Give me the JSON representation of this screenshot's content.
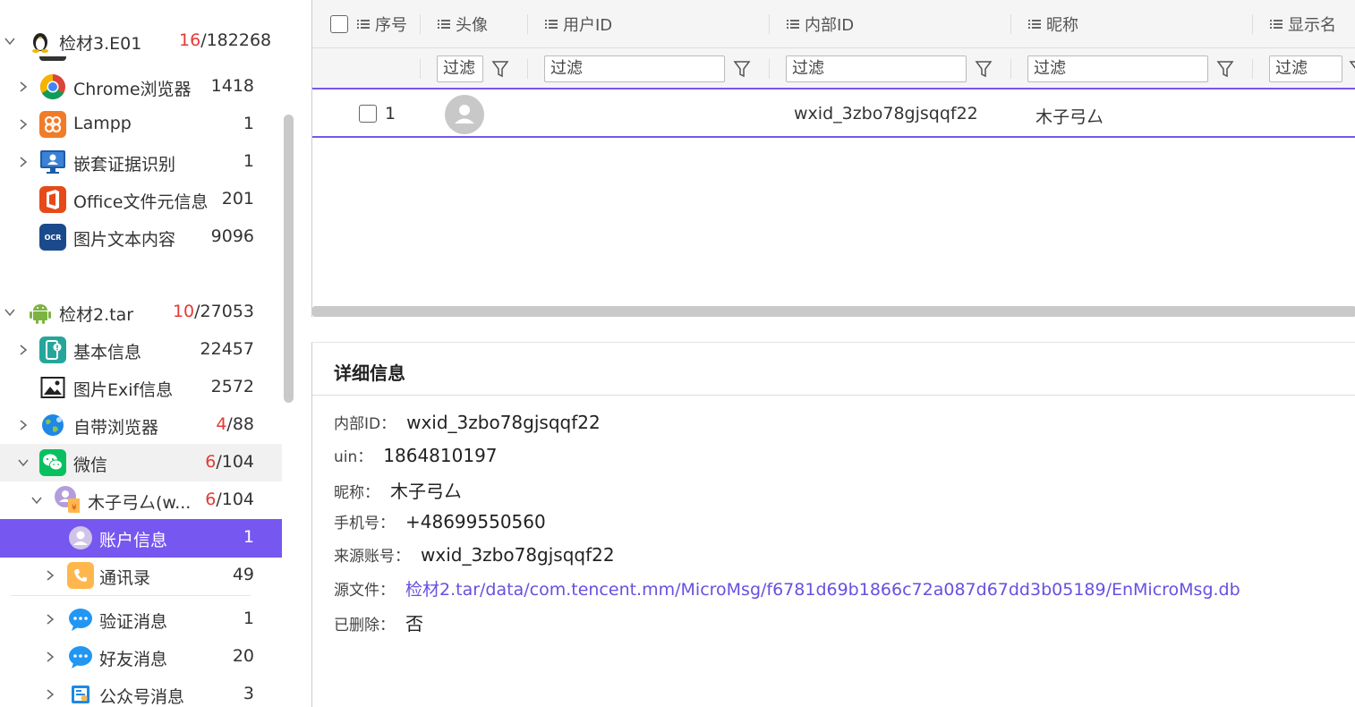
{
  "sidebar": {
    "items": [
      {
        "label": "检材3.E01",
        "count_red": "16",
        "count_rest": "/182268",
        "icon": "linux-penguin-icon"
      },
      {
        "label": "Chrome浏览器",
        "count_red": "",
        "count_rest": "1418",
        "icon": "chrome-icon"
      },
      {
        "label": "Lampp",
        "count_red": "",
        "count_rest": "1",
        "icon": "lampp-icon"
      },
      {
        "label": "嵌套证据识别",
        "count_red": "",
        "count_rest": "1",
        "icon": "monitor-user-icon"
      },
      {
        "label": "Office文件元信息",
        "count_red": "",
        "count_rest": "201",
        "icon": "office-icon"
      },
      {
        "label": "图片文本内容",
        "count_red": "",
        "count_rest": "9096",
        "icon": "ocr-icon",
        "icon_text": "OCR"
      },
      {
        "label": "检材2.tar",
        "count_red": "10",
        "count_rest": "/27053",
        "icon": "android-icon"
      },
      {
        "label": "基本信息",
        "count_red": "",
        "count_rest": "22457",
        "icon": "phone-info-icon"
      },
      {
        "label": "图片Exif信息",
        "count_red": "",
        "count_rest": "2572",
        "icon": "image-icon"
      },
      {
        "label": "自带浏览器",
        "count_red": "4",
        "count_rest": "/88",
        "icon": "browser-globe-icon"
      },
      {
        "label": "微信",
        "count_red": "6",
        "count_rest": "/104",
        "icon": "wechat-icon"
      },
      {
        "label": "木子弓厶(w...",
        "count_red": "6",
        "count_rest": "/104",
        "icon": "user-avatar-icon"
      },
      {
        "label": "账户信息",
        "count_red": "",
        "count_rest": "1",
        "icon": "account-icon"
      },
      {
        "label": "通讯录",
        "count_red": "",
        "count_rest": "49",
        "icon": "contacts-phone-icon"
      },
      {
        "label": "验证消息",
        "count_red": "",
        "count_rest": "1",
        "icon": "chat-bubble-icon"
      },
      {
        "label": "好友消息",
        "count_red": "",
        "count_rest": "20",
        "icon": "chat-bubble-icon"
      },
      {
        "label": "公众号消息",
        "count_red": "",
        "count_rest": "3",
        "icon": "public-account-icon"
      }
    ]
  },
  "grid": {
    "columns": [
      "序号",
      "头像",
      "用户ID",
      "内部ID",
      "昵称",
      "显示名"
    ],
    "filter_placeholder": "过滤",
    "rows": [
      {
        "index": "1",
        "user_id": "",
        "internal_id": "wxid_3zbo78gjsqqf22",
        "nickname": "木子弓厶",
        "display_name": ""
      }
    ]
  },
  "detail": {
    "title": "详细信息",
    "fields": [
      {
        "key": "内部ID：",
        "value": "wxid_3zbo78gjsqqf22"
      },
      {
        "key": "uin：",
        "value": "1864810197"
      },
      {
        "key": "昵称：",
        "value": "木子弓厶"
      },
      {
        "key": "手机号：",
        "value": "+48699550560"
      },
      {
        "key": "来源账号：",
        "value": "wxid_3zbo78gjsqqf22"
      },
      {
        "key": "源文件：",
        "value": "检材2.tar/data/com.tencent.mm/MicroMsg/f6781d69b1866c72a087d67dd3b05189/EnMicroMsg.db"
      },
      {
        "key": "已删除：",
        "value": "否"
      }
    ]
  },
  "colors": {
    "accent": "#7657f0",
    "count_red": "#e53935",
    "link": "#6a4fe0"
  }
}
